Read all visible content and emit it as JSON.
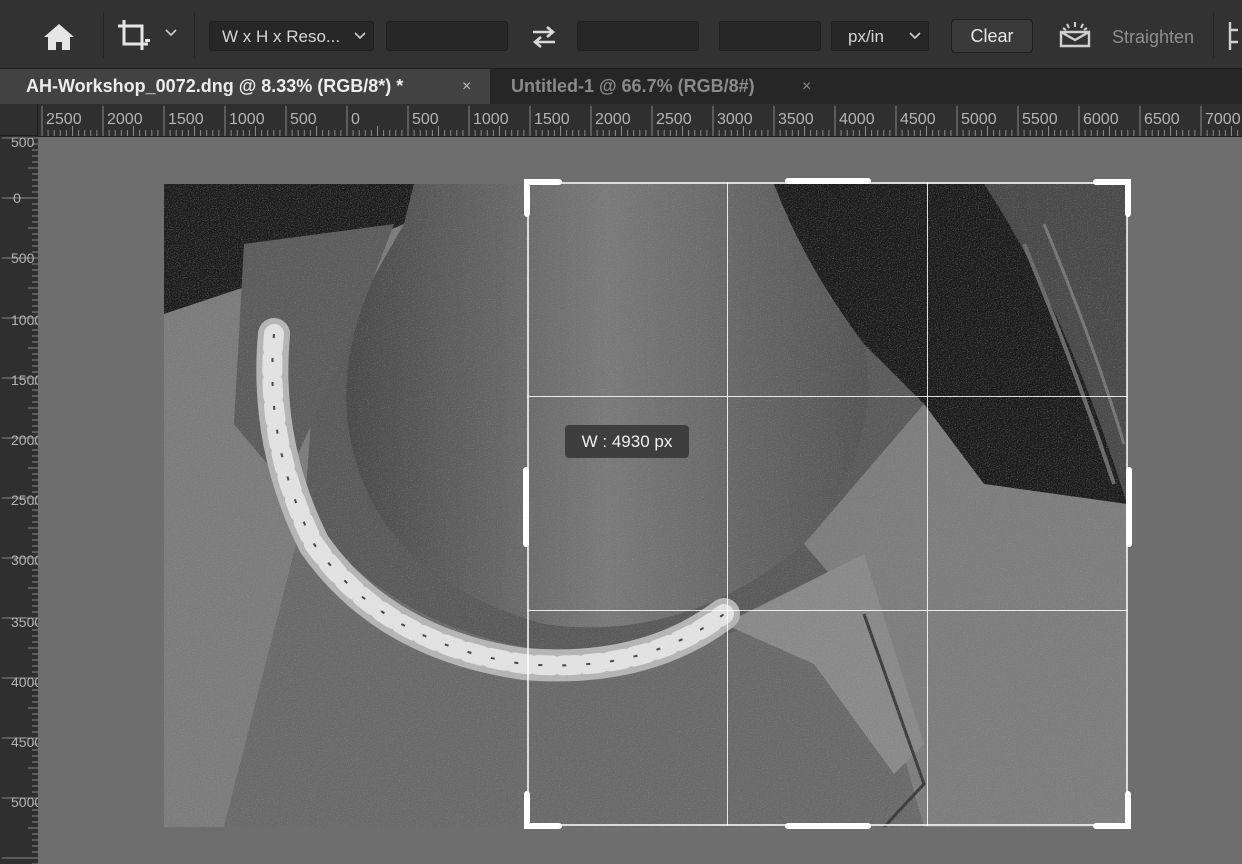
{
  "options_bar": {
    "aspect_ratio_select": "W x H x Reso...",
    "width_value": "",
    "height_value": "",
    "resolution_value": "",
    "units_select": "px/in",
    "clear_label": "Clear",
    "straighten_label": "Straighten"
  },
  "tabs": [
    {
      "label": "AH-Workshop_0072.dng @ 8.33% (RGB/8*) *",
      "close": "×",
      "active": true
    },
    {
      "label": "Untitled-1 @ 66.7% (RGB/8#)",
      "close": "×",
      "active": false
    }
  ],
  "ruler_top_labels": [
    "2500",
    "2000",
    "1500",
    "1000",
    "500",
    "0",
    "500",
    "1000",
    "1500",
    "2000",
    "2500",
    "3000",
    "3500",
    "4000",
    "4500",
    "5000",
    "5500",
    "6000",
    "6500",
    "7000"
  ],
  "ruler_left_labels": [
    "500",
    "0",
    "500",
    "1000",
    "1500",
    "2000",
    "2500",
    "3000",
    "3500",
    "4000",
    "4500",
    "5000"
  ],
  "canvas": {
    "size_tooltip": "W :  4930 px"
  },
  "colors": {
    "options_bar_bg": "#323232",
    "tab_active_bg": "#424242",
    "pasteboard": "#6e6e6e",
    "crop_handles": "#ffffff"
  },
  "icons": {
    "home": "home-icon",
    "crop": "crop-icon",
    "swap": "swap-icon",
    "straighten": "straighten-icon"
  }
}
